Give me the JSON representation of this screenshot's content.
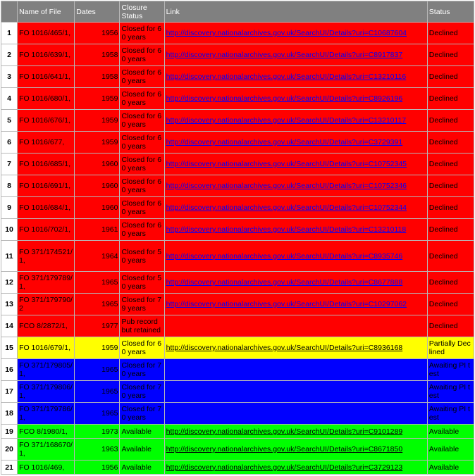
{
  "headers": [
    "Name of File",
    "Dates",
    "Closure Status",
    "Link",
    "Status"
  ],
  "colors": {
    "red": "#ff0000",
    "yellow": "#ffff00",
    "blue": "#0000ff",
    "green": "#00ff00",
    "header": "#808080"
  },
  "rows": [
    {
      "num": "1",
      "name": "FO 1016/465/1,",
      "date": "1956",
      "closure": "Closed for 60 years",
      "link": "http://discovery.nationalarchives.gov.uk/SearchUI/Details?uri=C10687604",
      "status": "Declined",
      "color": "red"
    },
    {
      "num": "2",
      "name": "FO 1016/639/1,",
      "date": "1958",
      "closure": "Closed for 60 years",
      "link": "http://discovery.nationalarchives.gov.uk/SearchUI/Details?uri=C8917837",
      "status": "Declined",
      "color": "red"
    },
    {
      "num": "3",
      "name": "FO 1016/641/1,",
      "date": "1958",
      "closure": "Closed for 60 years",
      "link": "http://discovery.nationalarchives.gov.uk/SearchUI/Details?uri=C13210116",
      "status": "Declined",
      "color": "red"
    },
    {
      "num": "4",
      "name": "FO 1016/680/1,",
      "date": "1959",
      "closure": "Closed for 60 years",
      "link": "http://discovery.nationalarchives.gov.uk/SearchUI/Details?uri=C8926196",
      "status": "Declined",
      "color": "red"
    },
    {
      "num": "5",
      "name": "FO 1016/676/1,",
      "date": "1959",
      "closure": "Closed for 60 years",
      "link": "http://discovery.nationalarchives.gov.uk/SearchUI/Details?uri=C13210117",
      "status": "Declined",
      "color": "red"
    },
    {
      "num": "6",
      "name": "FO 1016/677,",
      "date": "1959",
      "closure": "Closed for 60 years",
      "link": "http://discovery.nationalarchives.gov.uk/SearchUI/Details?uri=C3729391",
      "status": "Declined",
      "color": "red"
    },
    {
      "num": "7",
      "name": "FO 1016/685/1,",
      "date": "1960",
      "closure": "Closed for 60 years",
      "link": "http://discovery.nationalarchives.gov.uk/SearchUI/Details?uri=C10752345",
      "status": "Declined",
      "color": "red"
    },
    {
      "num": "8",
      "name": "FO 1016/691/1,",
      "date": "1960",
      "closure": "Closed for 60 years",
      "link": "http://discovery.nationalarchives.gov.uk/SearchUI/Details?uri=C10752346",
      "status": "Declined",
      "color": "red"
    },
    {
      "num": "9",
      "name": "FO 1016/684/1,",
      "date": "1960",
      "closure": "Closed for 60 years",
      "link": "http://discovery.nationalarchives.gov.uk/SearchUI/Details?uri=C10752344",
      "status": "Declined",
      "color": "red"
    },
    {
      "num": "10",
      "name": "FO 1016/702/1,",
      "date": "1961",
      "closure": "Closed for 60 years",
      "link": "http://discovery.nationalarchives.gov.uk/SearchUI/Details?uri=C13210118",
      "status": "Declined",
      "color": "red"
    },
    {
      "num": "11",
      "name": "FO 371/174521/1,",
      "date": "1964",
      "closure": "Closed for 50 years",
      "link": "http://discovery.nationalarchives.gov.uk/SearchUI/Details?uri=C8935746",
      "status": "Declined",
      "color": "red"
    },
    {
      "num": "12",
      "name": "FO 371/179789/1,",
      "date": "1965",
      "closure": "Closed for 50 years",
      "link": "http://discovery.nationalarchives.gov.uk/SearchUI/Details?uri=C8677888",
      "status": "Declined",
      "color": "red"
    },
    {
      "num": "13",
      "name": "FO 371/179790/2",
      "date": "1965",
      "closure": "Closed for 79 years",
      "link": "http://discovery.nationalarchives.gov.uk/SearchUI/Details?uri=C10297062",
      "status": "Declined",
      "color": "red"
    },
    {
      "num": "14",
      "name": "FCO 8/2872/1,",
      "date": "1977",
      "closure": "Pub record but retained",
      "link": "",
      "status": "Declined",
      "color": "red"
    },
    {
      "num": "15",
      "name": "FO 1016/679/1,",
      "date": "1959",
      "closure": "Closed for 60 years",
      "link": "http://discovery.nationalarchives.gov.uk/SearchUI/Details?uri=C8936168",
      "status": "Partially Declined",
      "color": "yellow"
    },
    {
      "num": "16",
      "name": "FO 371/179805/1,",
      "date": "1965",
      "closure": "Closed for 70 years",
      "link": "",
      "status": "Awaiting PI test",
      "color": "blue"
    },
    {
      "num": "17",
      "name": "FO 371/179806/1,",
      "date": "1965",
      "closure": "Closed for 70 years",
      "link": "",
      "status": "Awaiting PI test",
      "color": "blue"
    },
    {
      "num": "18",
      "name": "FO 371/179786/1,",
      "date": "1965",
      "closure": "Closed for 70 years",
      "link": "",
      "status": "Awaiting PI test",
      "color": "blue"
    },
    {
      "num": "19",
      "name": "FCO 8/1980/1,",
      "date": "1973",
      "closure": "Available",
      "link": "http://discovery.nationalarchives.gov.uk/SearchUI/Details?uri=C9101289",
      "status": "Available",
      "color": "green"
    },
    {
      "num": "20",
      "name": "FO 371/168670/1,",
      "date": "1963",
      "closure": "Available",
      "link": "http://discovery.nationalarchives.gov.uk/SearchUI/Details?uri=C8671850",
      "status": "Available",
      "color": "green"
    },
    {
      "num": "21",
      "name": "FO 1016/469,",
      "date": "1956",
      "closure": "Available",
      "link": "http://discovery.nationalarchives.gov.uk/SearchUI/Details?uri=C3729123",
      "status": "Available",
      "color": "green"
    }
  ]
}
